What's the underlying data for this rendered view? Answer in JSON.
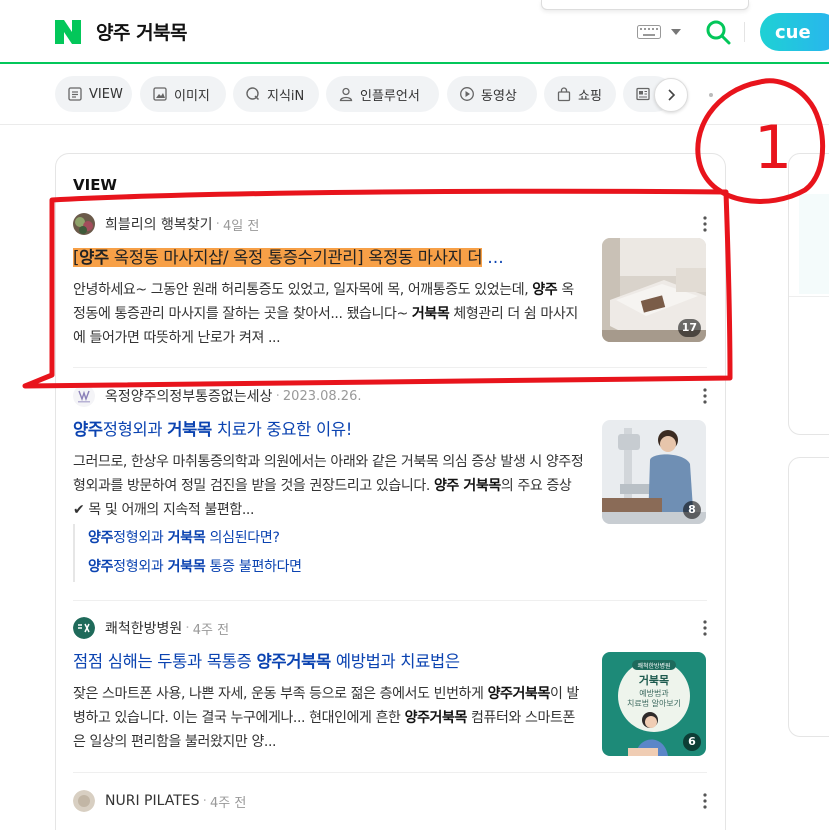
{
  "header": {
    "query": "양주 거북목",
    "cue_label": "cue"
  },
  "tabs": [
    {
      "label": "VIEW",
      "icon": "view-icon"
    },
    {
      "label": "이미지",
      "icon": "image-icon"
    },
    {
      "label": "지식iN",
      "icon": "kin-icon"
    },
    {
      "label": "인플루언서",
      "icon": "person-icon"
    },
    {
      "label": "동영상",
      "icon": "play-icon"
    },
    {
      "label": "쇼핑",
      "icon": "bag-icon"
    },
    {
      "label": "",
      "icon": "news-icon"
    }
  ],
  "section_title": "VIEW",
  "posts": [
    {
      "author": "희블리의 행복찾기",
      "date": "4일 전",
      "title_parts": [
        {
          "t": "[",
          "b": false,
          "hl": true
        },
        {
          "t": "양주",
          "b": true,
          "hl": true
        },
        {
          "t": " 옥정동 마사지샵/ 옥정 통증수기관리] 옥정동 마사지 더",
          "b": false,
          "hl": true
        },
        {
          "t": " …",
          "b": false,
          "hl": false
        }
      ],
      "desc_parts": [
        {
          "t": "안녕하세요~ 그동안 원래 허리통증도 있었고, 일자목에 목, 어깨통증도 있었는데, ",
          "b": false
        },
        {
          "t": "양주",
          "b": true
        },
        {
          "t": " 옥정동에 통증관리 마사지를 잘하는 곳을 찾아서... 됐습니다~ ",
          "b": false
        },
        {
          "t": "거북목",
          "b": true
        },
        {
          "t": " 체형관리 더 쉼 마사지에 들어가면 따뜻하게 난로가 켜져 ...",
          "b": false
        }
      ],
      "thumb_count": "17"
    },
    {
      "author": "옥정양주의정부통증없는세상",
      "date": "2023.08.26.",
      "title_parts": [
        {
          "t": "양주",
          "b": true
        },
        {
          "t": "정형외과 ",
          "b": false
        },
        {
          "t": "거북목",
          "b": true
        },
        {
          "t": " 치료가 중요한 이유!",
          "b": false
        }
      ],
      "desc_parts": [
        {
          "t": "그러므로, 한상우 마취통증의학과 의원에서는 아래와 같은 거북목 의심 증상 발생 시 양주정형외과를 방문하여 정밀 검진을 받을 것을 권장드리고 있습니다. ",
          "b": false
        },
        {
          "t": "양주 거북목",
          "b": true
        },
        {
          "t": "의 주요 증상 ",
          "b": false
        },
        {
          "t": "✔",
          "b": false
        },
        {
          "t": " 목 및 어깨의 지속적 불편함...",
          "b": false
        }
      ],
      "thumb_count": "8",
      "sublinks": [
        [
          {
            "t": "양주",
            "b": true
          },
          {
            "t": "정형외과 ",
            "b": false
          },
          {
            "t": "거북목",
            "b": true
          },
          {
            "t": " 의심된다면?",
            "b": false
          }
        ],
        [
          {
            "t": "양주",
            "b": true
          },
          {
            "t": "정형외과 ",
            "b": false
          },
          {
            "t": "거북목",
            "b": true
          },
          {
            "t": " 통증 불편하다면",
            "b": false
          }
        ]
      ]
    },
    {
      "author": "쾌척한방병원",
      "date": "4주 전",
      "title_parts": [
        {
          "t": "점점 심해는 두통과 목통증 ",
          "b": false
        },
        {
          "t": "양주거북목",
          "b": true
        },
        {
          "t": " 예방법과 치료법은",
          "b": false
        }
      ],
      "desc_parts": [
        {
          "t": "잦은 스마트폰 사용, 나쁜 자세, 운동 부족 등으로 젊은 층에서도 빈번하게 ",
          "b": false
        },
        {
          "t": "양주거북목",
          "b": true
        },
        {
          "t": "이 발병하고 있습니다. 이는 결국 누구에게나... 현대인에게 흔한 ",
          "b": false
        },
        {
          "t": "양주거북목",
          "b": true
        },
        {
          "t": " 컴퓨터와 스마트폰은 일상의 편리함을 불러왔지만 양...",
          "b": false
        }
      ],
      "thumb_count": "6",
      "thumb_text": {
        "tag": "쾌척한방병원",
        "title": "거북목",
        "line1": "예방법과",
        "line2": "치료법 알아보기"
      }
    },
    {
      "author": "NURI PILATES",
      "date": "4주 전"
    }
  ],
  "annotation": {
    "label": "1",
    "color": "#e8141c"
  },
  "colors": {
    "brand_green": "#03c75a",
    "link_blue": "#0b43b1",
    "highlight": "#f7a047"
  }
}
